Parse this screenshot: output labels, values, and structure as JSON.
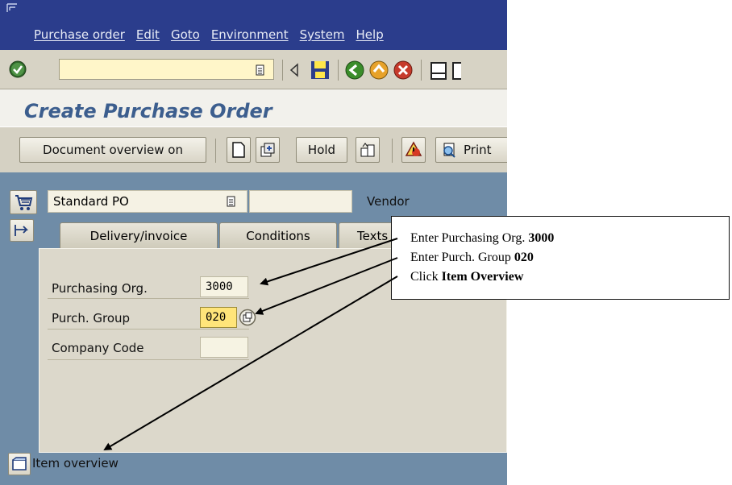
{
  "menubar": {
    "items": [
      "Purchase order",
      "Edit",
      "Goto",
      "Environment",
      "System",
      "Help"
    ]
  },
  "toolbar": {
    "command_field_value": "",
    "icons": [
      "enter-icon",
      "history-dropdown-icon",
      "back-arrow-icon",
      "save-icon",
      "back-icon",
      "exit-icon",
      "cancel-icon",
      "print-icon",
      "find-icon"
    ]
  },
  "title": "Create Purchase Order",
  "app_toolbar": {
    "doc_overview_label": "Document overview on",
    "hold_label": "Hold",
    "print_label": "Print"
  },
  "header": {
    "doc_type_value": "Standard PO",
    "vendor_label": "Vendor"
  },
  "tabs": [
    {
      "label": "Delivery/invoice"
    },
    {
      "label": "Conditions"
    },
    {
      "label": "Texts"
    }
  ],
  "form": {
    "purch_org_label": "Purchasing Org.",
    "purch_org_value": "3000",
    "purch_group_label": "Purch. Group",
    "purch_group_value": "020",
    "company_code_label": "Company Code",
    "company_code_value": ""
  },
  "item_overview_label": "Item overview",
  "callout": {
    "line1_prefix": "Enter Purchasing Org. ",
    "line1_bold": "3000",
    "line2_prefix": "Enter Purch. Group ",
    "line2_bold": "020",
    "line3_prefix": "Click ",
    "line3_bold": "Item Overview"
  },
  "colors": {
    "menubar": "#2b3d8c",
    "title": "#3c5e8e",
    "workarea": "#6f8ca7",
    "focus_field": "#ffe57a"
  }
}
